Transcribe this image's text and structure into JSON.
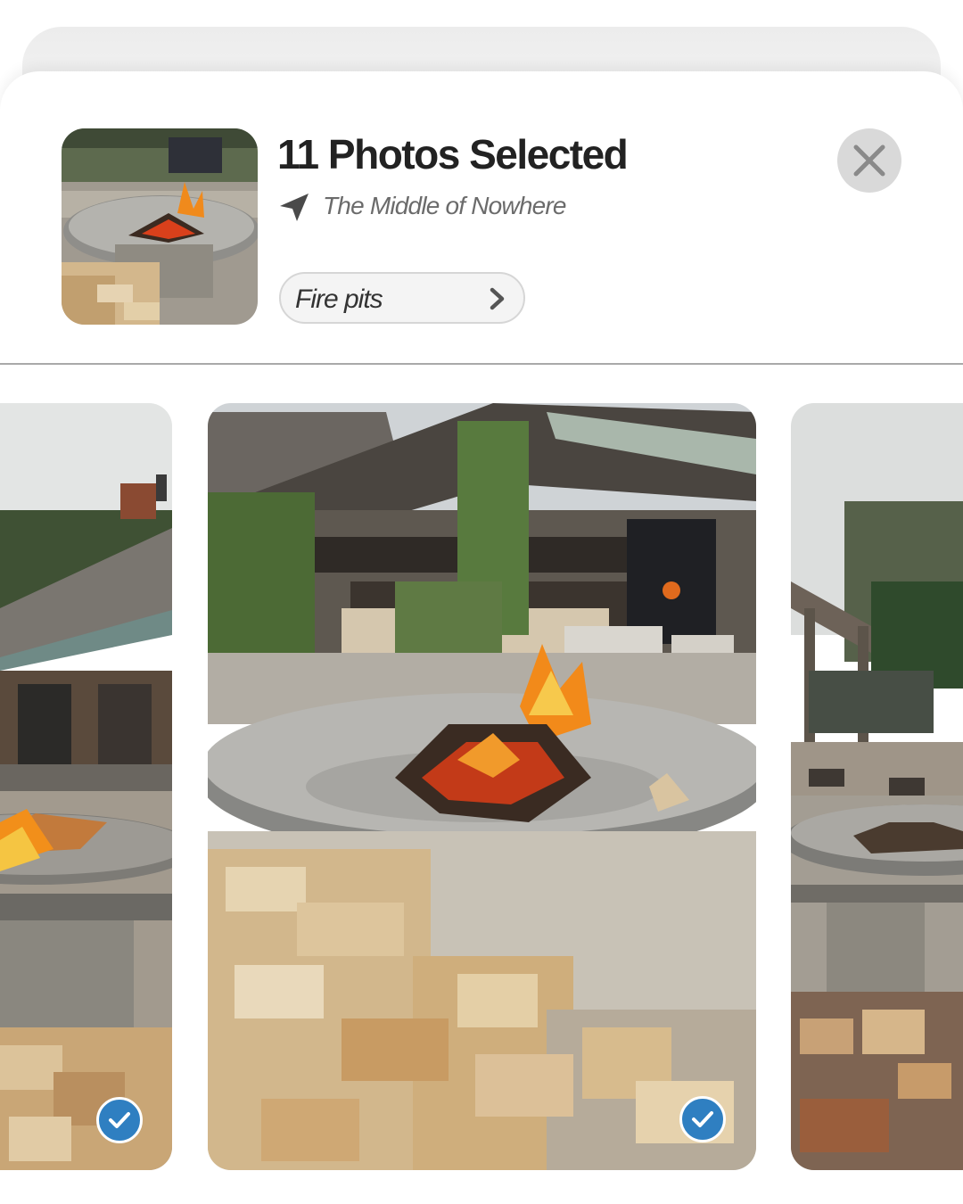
{
  "header": {
    "title": "11 Photos Selected",
    "location": "The Middle of Nowhere",
    "tag_label": "Fire pits"
  },
  "icons": {
    "location": "location-arrow-icon",
    "tag_chevron": "chevron-right-icon",
    "close": "close-icon",
    "selected": "checkmark-icon"
  },
  "photos": [
    {
      "position": "previous",
      "selected": true
    },
    {
      "position": "current",
      "selected": true
    },
    {
      "position": "next",
      "selected": false
    }
  ],
  "colors": {
    "title": "#222222",
    "subtitle": "#6b6b6b",
    "check_badge": "#2f7fc1",
    "close_button": "#d9d9d9",
    "divider": "#a9a9a9"
  }
}
